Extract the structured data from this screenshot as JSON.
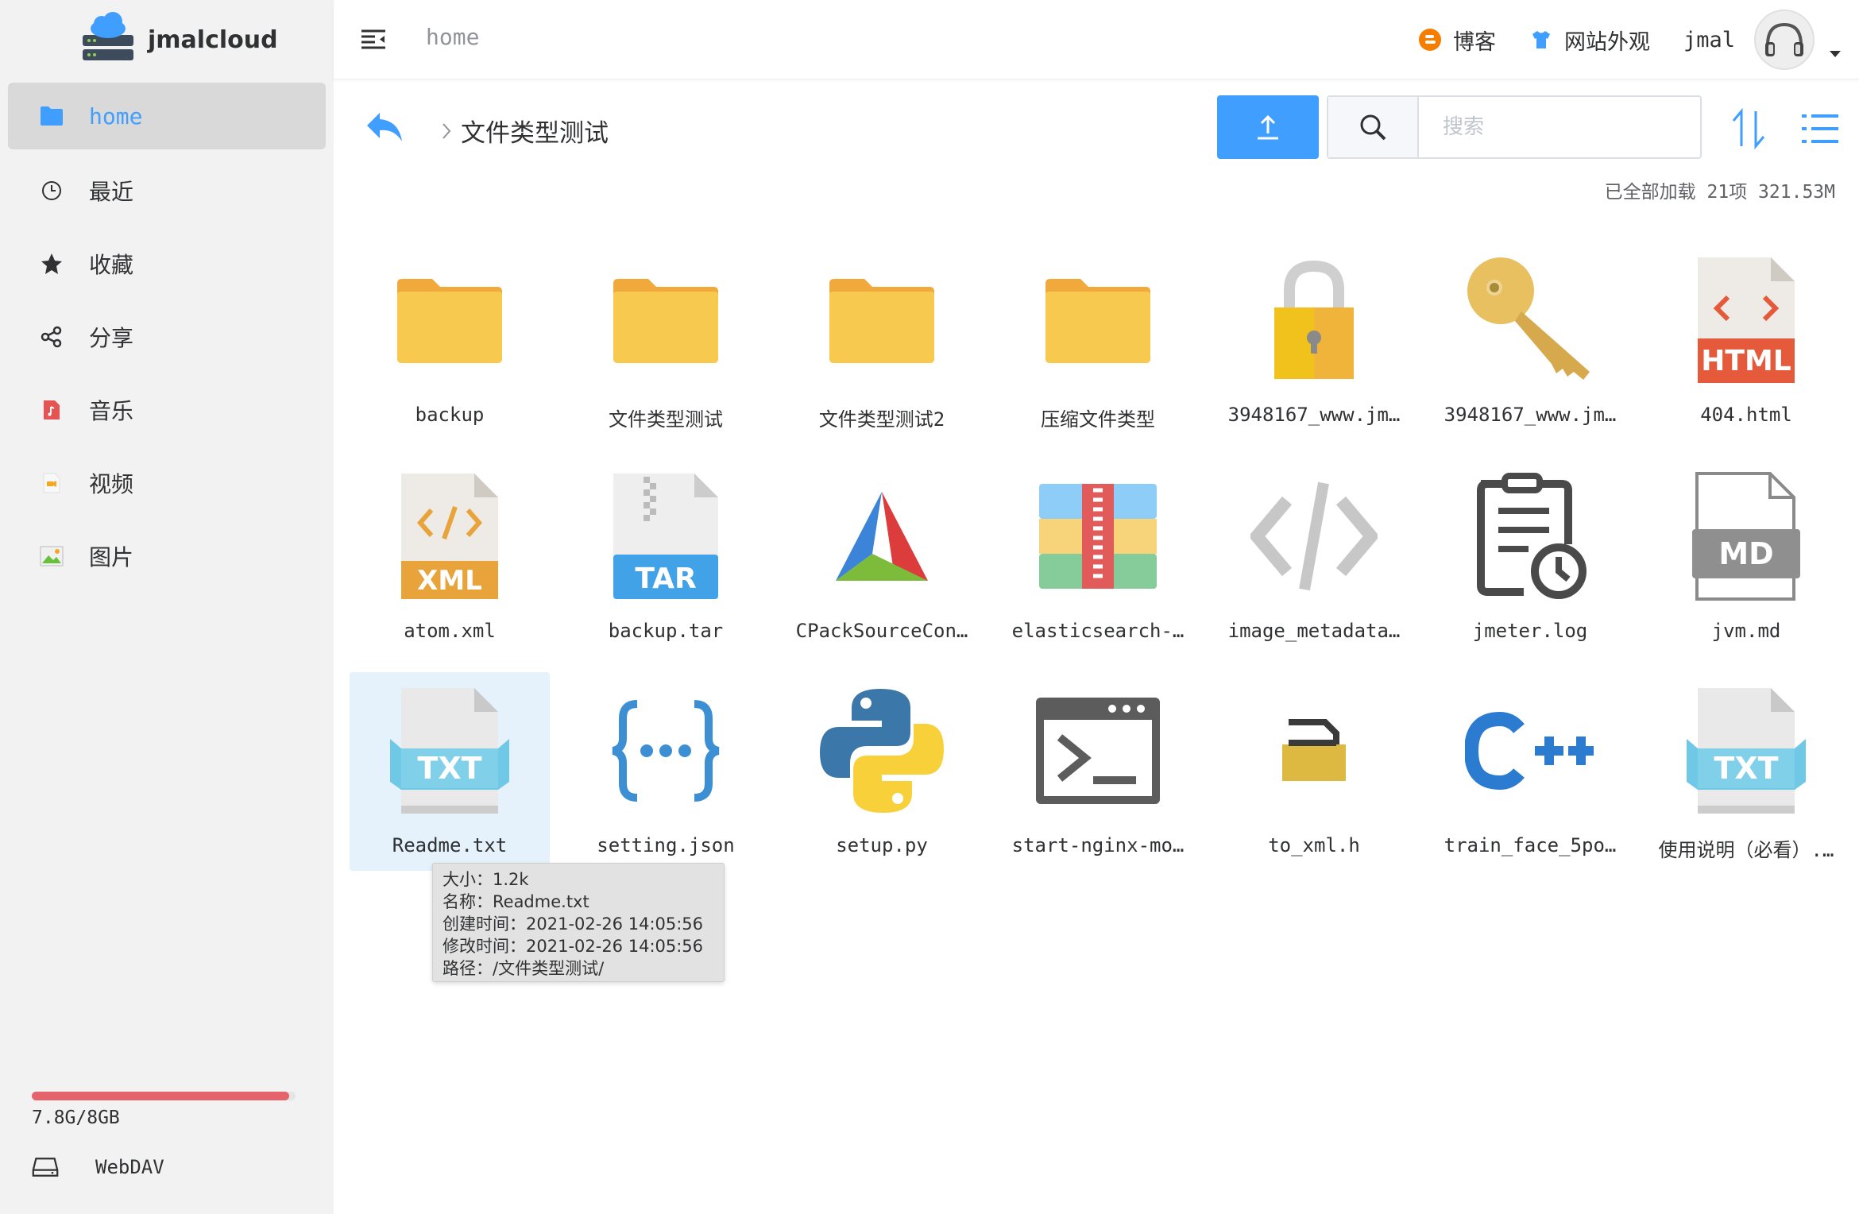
{
  "app": {
    "name": "jmalcloud"
  },
  "sidebar": {
    "items": [
      {
        "label": "home",
        "icon": "folder-icon",
        "active": true
      },
      {
        "label": "最近",
        "icon": "clock-icon"
      },
      {
        "label": "收藏",
        "icon": "star-icon"
      },
      {
        "label": "分享",
        "icon": "share-icon"
      },
      {
        "label": "音乐",
        "icon": "music-icon"
      },
      {
        "label": "视频",
        "icon": "video-icon"
      },
      {
        "label": "图片",
        "icon": "image-icon"
      }
    ],
    "storage": {
      "text": "7.8G/8GB",
      "used_fraction": 0.975
    },
    "webdav_label": "WebDAV"
  },
  "header": {
    "title": "home",
    "blog_label": "博客",
    "theme_label": "网站外观",
    "username": "jmal"
  },
  "toolbar": {
    "breadcrumb_current": "文件类型测试",
    "search_placeholder": "搜索",
    "summary": "已全部加载 21项 321.53M"
  },
  "files": [
    {
      "name": "backup",
      "icon": "folder-icon"
    },
    {
      "name": "文件类型测试",
      "icon": "folder-icon"
    },
    {
      "name": "文件类型测试2",
      "icon": "folder-icon"
    },
    {
      "name": "压缩文件类型",
      "icon": "folder-icon"
    },
    {
      "name": "3948167_www.jm…",
      "icon": "lock-icon"
    },
    {
      "name": "3948167_www.jm…",
      "icon": "key-icon"
    },
    {
      "name": "404.html",
      "icon": "html-file-icon",
      "badge": "HTML"
    },
    {
      "name": "atom.xml",
      "icon": "xml-file-icon",
      "badge": "XML"
    },
    {
      "name": "backup.tar",
      "icon": "tar-file-icon",
      "badge": "TAR"
    },
    {
      "name": "CPackSourceCon…",
      "icon": "cmake-icon"
    },
    {
      "name": "elasticsearch-…",
      "icon": "archive-icon"
    },
    {
      "name": "image_metadata…",
      "icon": "code-icon"
    },
    {
      "name": "jmeter.log",
      "icon": "log-file-icon"
    },
    {
      "name": "jvm.md",
      "icon": "md-file-icon",
      "badge": "MD"
    },
    {
      "name": "Readme.txt",
      "icon": "txt-file-icon",
      "badge": "TXT",
      "selected": true
    },
    {
      "name": "setting.json",
      "icon": "json-icon"
    },
    {
      "name": "setup.py",
      "icon": "python-icon"
    },
    {
      "name": "start-nginx-mo…",
      "icon": "terminal-icon"
    },
    {
      "name": "to_xml.h",
      "icon": "header-file-icon"
    },
    {
      "name": "train_face_5po…",
      "icon": "cpp-icon",
      "badge": "C++"
    },
    {
      "name": "使用说明（必看）.…",
      "icon": "txt-file-icon",
      "badge": "TXT"
    }
  ],
  "tooltip": {
    "size": "大小：1.2k",
    "name": "名称：Readme.txt",
    "created": "创建时间：2021-02-26 14:05:56",
    "modified": "修改时间：2021-02-26 14:05:56",
    "path": "路径：/文件类型测试/"
  },
  "colors": {
    "accent": "#409eff",
    "storage": "#e5636a",
    "folder": "#f7c94f"
  }
}
